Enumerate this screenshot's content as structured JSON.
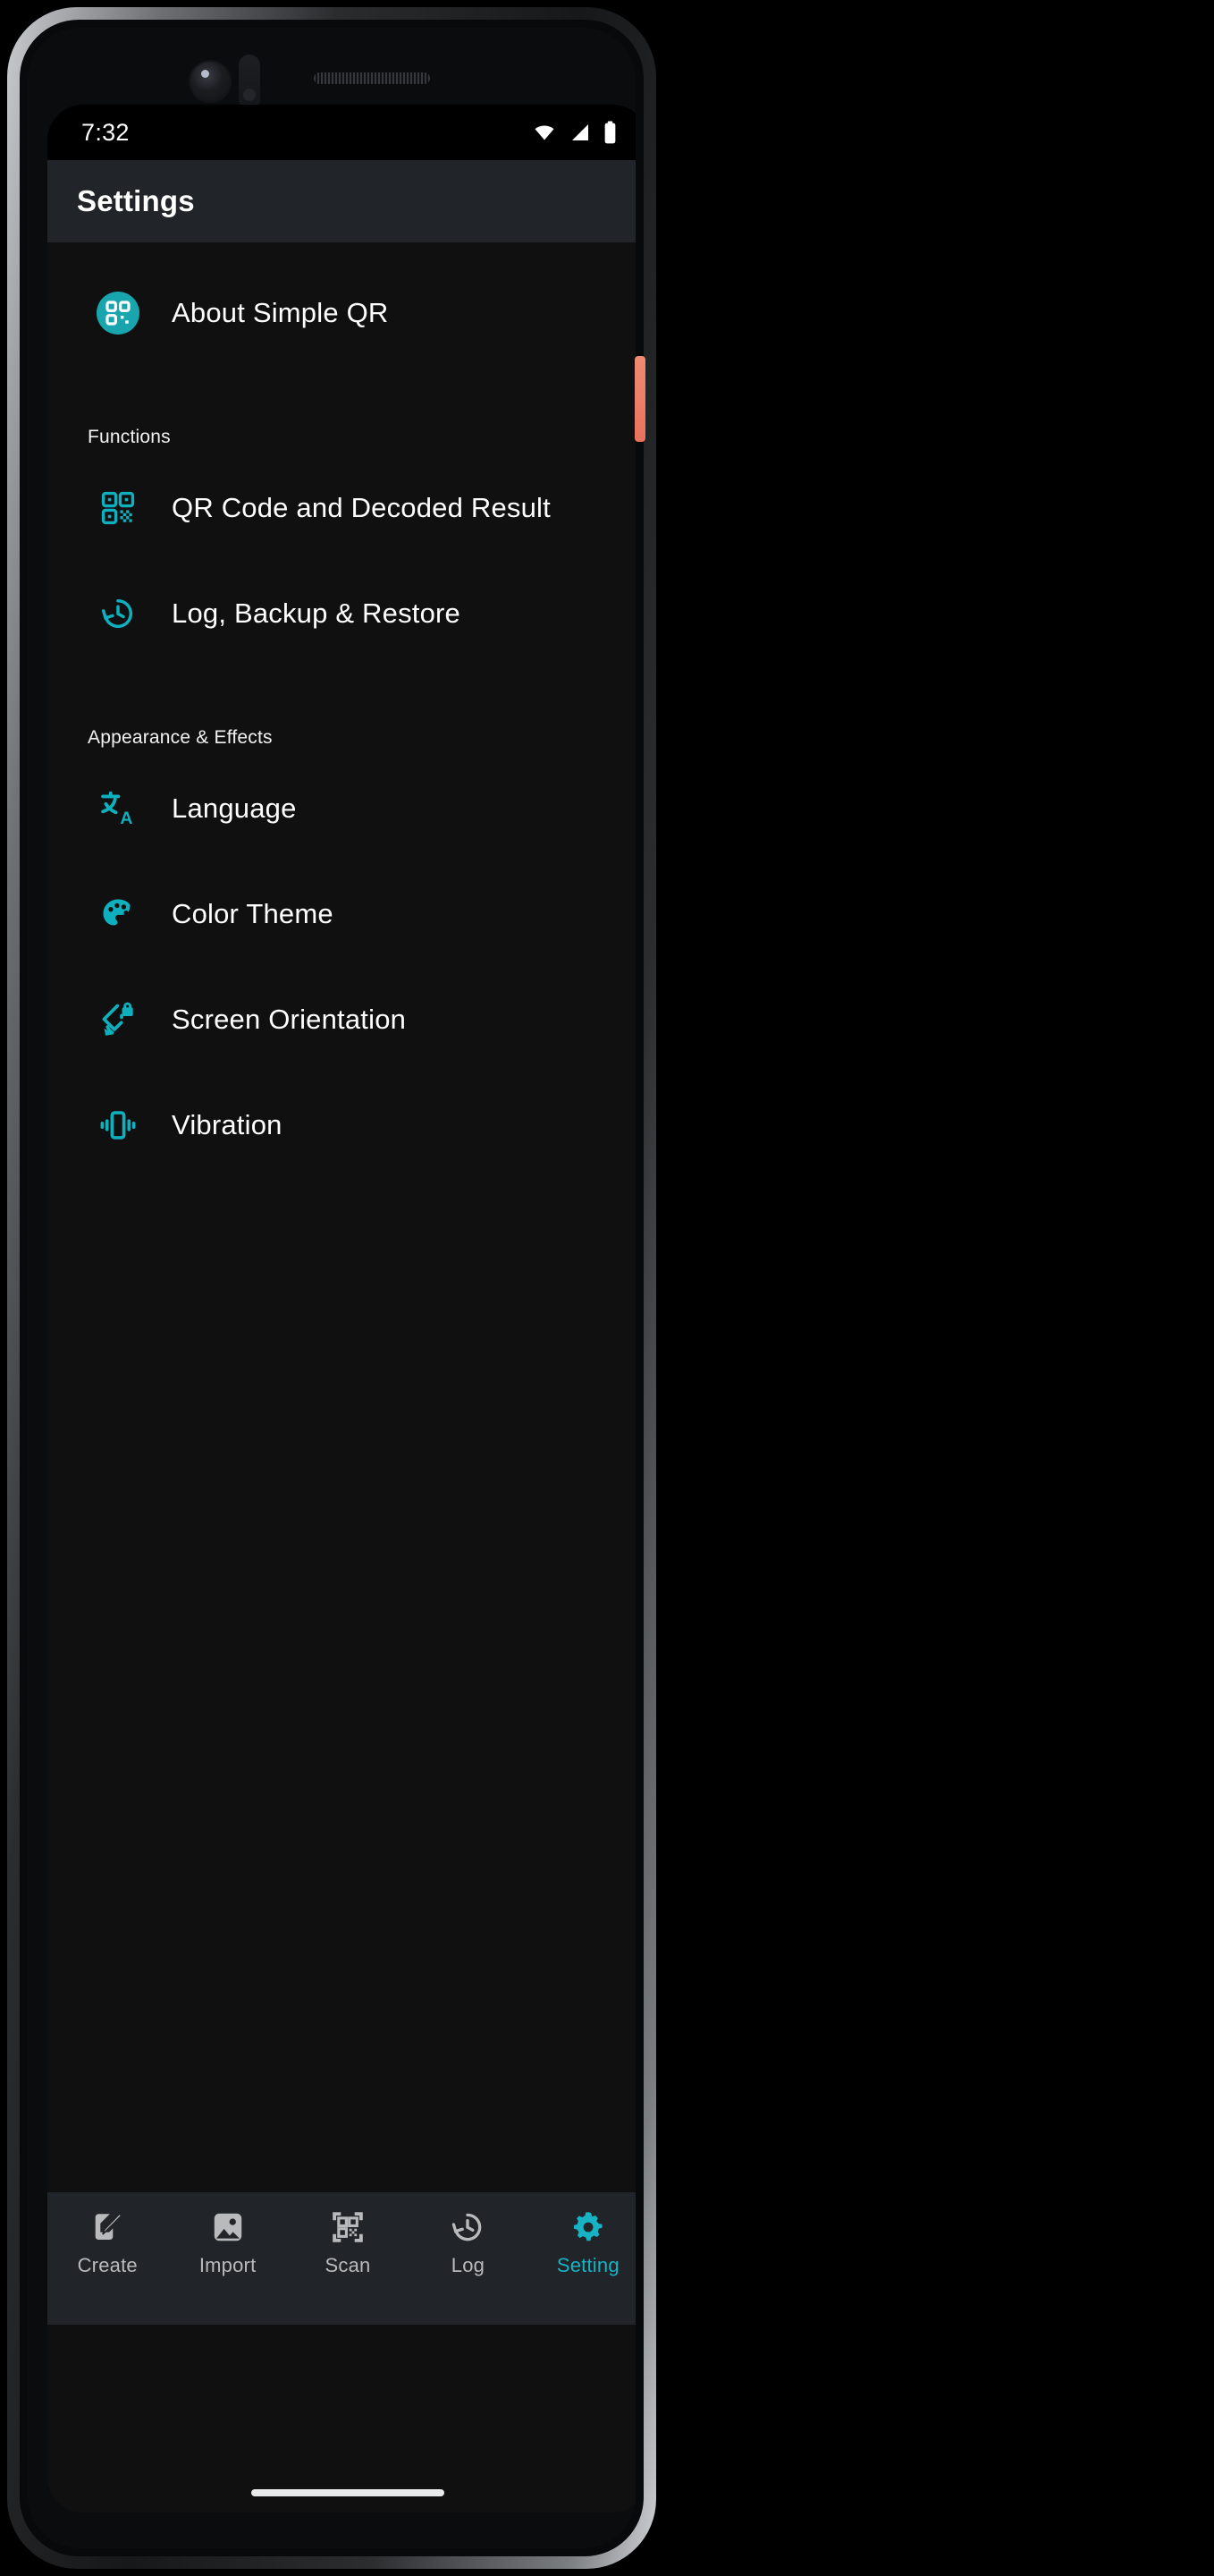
{
  "theme": {
    "accent": "#17b3c4",
    "icon_teal": "#0fb0bd",
    "app_icon_bg": "#18a5ad",
    "screen_bg": "#101011",
    "bar_bg": "#212428",
    "text_primary": "#ffffff",
    "nav_inactive": "#b9babb",
    "volume_button": "#e8735c"
  },
  "status_bar": {
    "time": "7:32",
    "icons": [
      "wifi-icon",
      "cellular-signal-icon",
      "battery-icon"
    ]
  },
  "app_bar": {
    "title": "Settings"
  },
  "settings": {
    "about": {
      "label": "About Simple QR",
      "icon": "simple-qr-app-icon"
    },
    "sections": [
      {
        "header": "Functions",
        "items": [
          {
            "label": "QR Code and Decoded Result",
            "icon": "qr-code-icon"
          },
          {
            "label": "Log, Backup & Restore",
            "icon": "history-clock-icon"
          }
        ]
      },
      {
        "header": "Appearance & Effects",
        "items": [
          {
            "label": "Language",
            "icon": "translate-icon"
          },
          {
            "label": "Color Theme",
            "icon": "palette-icon"
          },
          {
            "label": "Screen Orientation",
            "icon": "screen-rotation-lock-icon"
          },
          {
            "label": "Vibration",
            "icon": "vibration-icon"
          }
        ]
      }
    ]
  },
  "bottom_nav": {
    "items": [
      {
        "label": "Create",
        "icon": "create-pencil-icon",
        "active": false
      },
      {
        "label": "Import",
        "icon": "image-import-icon",
        "active": false
      },
      {
        "label": "Scan",
        "icon": "qr-scan-icon",
        "active": false
      },
      {
        "label": "Log",
        "icon": "history-log-icon",
        "active": false
      },
      {
        "label": "Setting",
        "icon": "gear-icon",
        "active": true
      }
    ],
    "active_index": 4
  }
}
